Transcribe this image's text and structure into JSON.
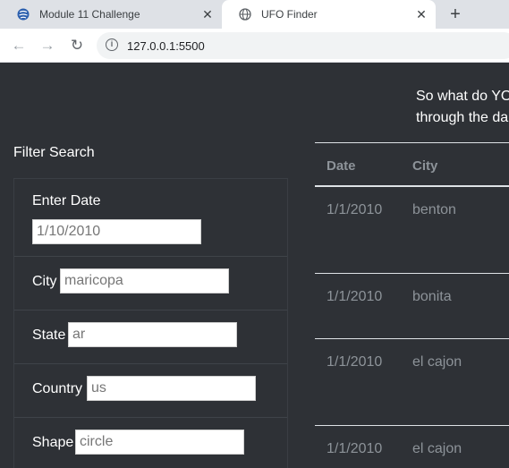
{
  "browser": {
    "tabs": [
      {
        "title": "Module 11 Challenge",
        "icon": "globe-icon",
        "active": false
      },
      {
        "title": "UFO Finder",
        "icon": "globe-icon",
        "active": true
      }
    ],
    "new_tab_label": "+",
    "url": "127.0.0.1:5500",
    "colors": {
      "tab_strip": "#dee1e6",
      "active_tab": "#ffffff",
      "omnibox": "#f1f3f4"
    }
  },
  "page": {
    "intro_line1": "So what do YO",
    "intro_line2": "through the da",
    "filter": {
      "title": "Filter Search",
      "fields": [
        {
          "label": "Enter Date",
          "value": "1/10/2010"
        },
        {
          "label": "City",
          "value": "maricopa"
        },
        {
          "label": "State",
          "value": "ar"
        },
        {
          "label": "Country",
          "value": "us"
        },
        {
          "label": "Shape",
          "value": "circle"
        }
      ]
    },
    "table": {
      "headers": [
        "Date",
        "City"
      ],
      "rows": [
        [
          "1/1/2010",
          "benton"
        ],
        [
          "1/1/2010",
          "bonita"
        ],
        [
          "1/1/2010",
          "el cajon"
        ],
        [
          "1/1/2010",
          "el cajon"
        ]
      ]
    },
    "colors": {
      "background": "#2e3136",
      "text": "#ffffff",
      "table_text": "#8d9399",
      "table_border": "#dee2e6"
    }
  }
}
